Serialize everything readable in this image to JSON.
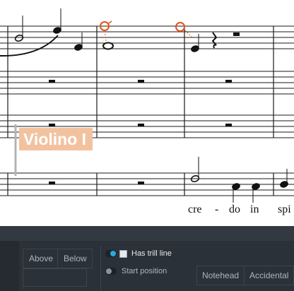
{
  "score": {
    "instrument_label": "Violino I",
    "lyrics": [
      "cre",
      "-",
      "do",
      "in",
      "spi"
    ]
  },
  "panel": {
    "placement_buttons": [
      "Above",
      "Below"
    ],
    "trill_line_label": "Has trill line",
    "trill_line_toggle_on": true,
    "trill_line_checked": false,
    "start_position_label": "Start position",
    "start_position_toggle_on": false,
    "type_buttons": [
      "Notehead",
      "Accidental"
    ]
  },
  "colors": {
    "selection": "#f2c29f",
    "trill_marker": "#e0521e",
    "toggle_on": "#2aa8e0",
    "panel_bg": "#2b3138"
  }
}
